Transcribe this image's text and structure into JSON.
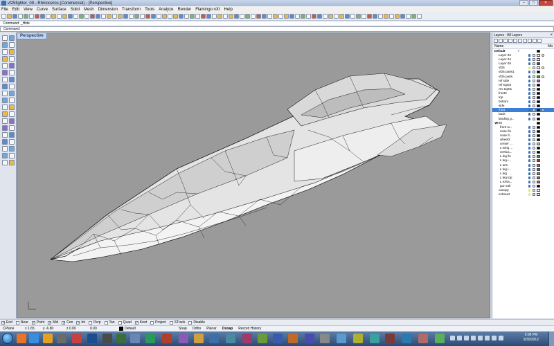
{
  "window": {
    "title": "vf25fighter_09 - Rhinoceros (Commercial) - [Perspective]",
    "close_glyph": "✕",
    "min_glyph": "–",
    "max_glyph": "□"
  },
  "menu": [
    "File",
    "Edit",
    "View",
    "Curve",
    "Surface",
    "Solid",
    "Mesh",
    "Dimension",
    "Transform",
    "Tools",
    "Analyze",
    "Render",
    "Flamingo nXt",
    "Help"
  ],
  "command": {
    "history": "Command: _Hide",
    "prompt": "Command:"
  },
  "viewport": {
    "label": "Perspective",
    "background": "#9a9a9a"
  },
  "layers_panel": {
    "title": "Layers - All Layers",
    "close_glyph": "×",
    "col_name": "Name",
    "col_material": "Ma",
    "rows": [
      {
        "name": "Default",
        "current": true,
        "color": "#000000",
        "level": "top"
      },
      {
        "name": "Layer 03",
        "color": "#ffffff",
        "material": true
      },
      {
        "name": "Layer 04",
        "color": "#ffffff"
      },
      {
        "name": "Layer 05",
        "color": "#1e4fb0"
      },
      {
        "name": "vf25",
        "color": "#ffffff",
        "material": true,
        "bulb_off": true
      },
      {
        "name": "vf25 parts1",
        "color": "#000000"
      },
      {
        "name": "vf25 parts",
        "color": "#4c8a3c",
        "material": true
      },
      {
        "name": "ref side",
        "color": "#b04fb0"
      },
      {
        "name": "ref top02",
        "color": "#000000"
      },
      {
        "name": "rev top01",
        "color": "#000000"
      },
      {
        "name": "front2",
        "color": "#000000"
      },
      {
        "name": "top",
        "color": "#000000"
      },
      {
        "name": "bottom",
        "color": "#000000"
      },
      {
        "name": "side",
        "color": "#000000"
      },
      {
        "name": "front",
        "color": "#000000",
        "selected": true,
        "material": true
      },
      {
        "name": "back",
        "color": "#000000"
      },
      {
        "name": "landing g...",
        "color": "#000000"
      },
      {
        "name": "VF25",
        "color": "#000000",
        "level": "top",
        "expander": "⊟"
      },
      {
        "name": "front w...",
        "color": "#000000",
        "indent": true
      },
      {
        "name": "nose fin",
        "color": "#000000",
        "indent": true
      },
      {
        "name": "nose fr...",
        "color": "#000000",
        "indent": true
      },
      {
        "name": "wheel2",
        "color": "#000000",
        "indent": true
      },
      {
        "name": "center ...",
        "color": "#c8c8c8",
        "indent": true
      },
      {
        "name": "L wing ...",
        "color": "#000000",
        "indent": true
      },
      {
        "name": "vertica...",
        "color": "#000000",
        "indent": true
      },
      {
        "name": "L leg fin",
        "color": "#3c8a3c",
        "indent": true
      },
      {
        "name": "L leg i...",
        "color": "#b02c2c",
        "indent": true
      },
      {
        "name": "L arm",
        "color": "#b04fb0",
        "indent": true
      },
      {
        "name": "L leg l...",
        "color": "#7a4fb0",
        "indent": true
      },
      {
        "name": "L leg",
        "color": "#b07a4f",
        "indent": true
      },
      {
        "name": "L leg top",
        "color": "#3c8a3c",
        "indent": true
      },
      {
        "name": "L exha...",
        "color": "#b04fb0",
        "indent": true
      },
      {
        "name": "gun rail",
        "color": "#000000",
        "indent": true
      },
      {
        "name": "canopy",
        "color": "#ffffff",
        "bulb_off": true
      },
      {
        "name": "exhaust",
        "color": "#ffffff",
        "bulb_off": true
      }
    ]
  },
  "osnap": [
    "End",
    "Near",
    "Point",
    "Mid",
    "Cen",
    "Int",
    "Perp",
    "Tan",
    "Quad",
    "Knot",
    "Project",
    "STrack",
    "Disable"
  ],
  "osnap_checked": [
    "End",
    "Point",
    "Mid",
    "Cen",
    "Int",
    "Knot"
  ],
  "status": {
    "cplane": "CPlane",
    "x": "x 1.65",
    "y": "y -6.80",
    "z": "z 0.00",
    "zval": "0.00",
    "layer": "Default",
    "toggles": [
      "Snap",
      "Ortho",
      "Planar",
      "Osnap",
      "Record History"
    ]
  },
  "taskbar": {
    "time": "5:08 PM",
    "date": "9/30/2012",
    "app_colors": [
      "#e8742a",
      "#3a8ee0",
      "#e6a020",
      "#6b6b6b",
      "#c84040",
      "#1b4d8f",
      "#4a4a4a",
      "#3a6f3a",
      "#6a86b5",
      "#2a9a5a",
      "#b0402a",
      "#8a5ab5",
      "#d0a040",
      "#3c6fa8",
      "#4a8aa0",
      "#a03a6a",
      "#6a9a3a",
      "#3a5ab0",
      "#c06a2a",
      "#4a4ab0",
      "#888888",
      "#5a9ad0",
      "#b0b030",
      "#3aa0a0",
      "#7a3a3a",
      "#2a7ab0",
      "#b06a6a",
      "#5ab05a"
    ]
  }
}
